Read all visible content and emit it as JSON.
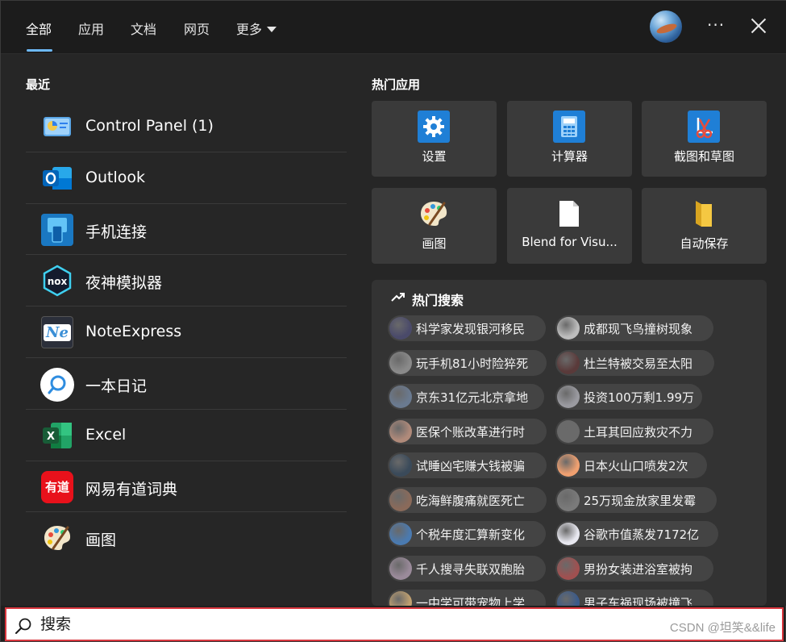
{
  "tabs": [
    {
      "label": "全部"
    },
    {
      "label": "应用"
    },
    {
      "label": "文档"
    },
    {
      "label": "网页"
    },
    {
      "label": "更多"
    }
  ],
  "header": {
    "more_dots": "···"
  },
  "recent": {
    "title": "最近",
    "items": [
      {
        "label": "Control Panel (1)",
        "icon": "control-panel-icon"
      },
      {
        "label": "Outlook",
        "icon": "outlook-icon"
      },
      {
        "label": "手机连接",
        "icon": "phone-link-icon"
      },
      {
        "label": "夜神模拟器",
        "icon": "nox-icon"
      },
      {
        "label": "NoteExpress",
        "icon": "noteexpress-icon"
      },
      {
        "label": "一本日记",
        "icon": "diary-icon"
      },
      {
        "label": "Excel",
        "icon": "excel-icon"
      },
      {
        "label": "网易有道词典",
        "icon": "youdao-icon"
      },
      {
        "label": "画图",
        "icon": "paint-icon"
      }
    ],
    "nox_glyph": "nox",
    "ne_glyph": "Ne",
    "excel_glyph": "X",
    "youdao_glyph": "有道"
  },
  "hot_apps": {
    "title": "热门应用",
    "items": [
      {
        "label": "设置",
        "icon": "gear-icon"
      },
      {
        "label": "计算器",
        "icon": "calculator-icon"
      },
      {
        "label": "截图和草图",
        "icon": "snip-sketch-icon"
      },
      {
        "label": "画图",
        "icon": "paint-icon"
      },
      {
        "label": "Blend for Visu...",
        "icon": "file-icon"
      },
      {
        "label": "自动保存",
        "icon": "folder-icon"
      }
    ]
  },
  "hot_search": {
    "title": "热门搜索",
    "left": [
      "科学家发现银河移民",
      "玩手机81小时险猝死",
      "京东31亿元北京拿地",
      "医保个账改革进行时",
      "试睡凶宅赚大钱被骗",
      "吃海鲜腹痛就医死亡",
      "个税年度汇算新变化",
      "千人搜寻失联双胞胎",
      "一中学可带宠物上学"
    ],
    "right": [
      "成都现飞鸟撞树现象",
      "杜兰特被交易至太阳",
      "投资100万剩1.99万",
      "土耳其回应救灾不力",
      "日本火山口喷发2次",
      "25万现金放家里发霉",
      "谷歌市值蒸发7172亿",
      "男扮女装进浴室被拘",
      "男子车祸现场被撞飞"
    ]
  },
  "search": {
    "placeholder": "搜索"
  },
  "watermark": "CSDN @坦笑&&life",
  "colors": {
    "accent": "#6cb8f6",
    "search_border": "#d9363e"
  }
}
